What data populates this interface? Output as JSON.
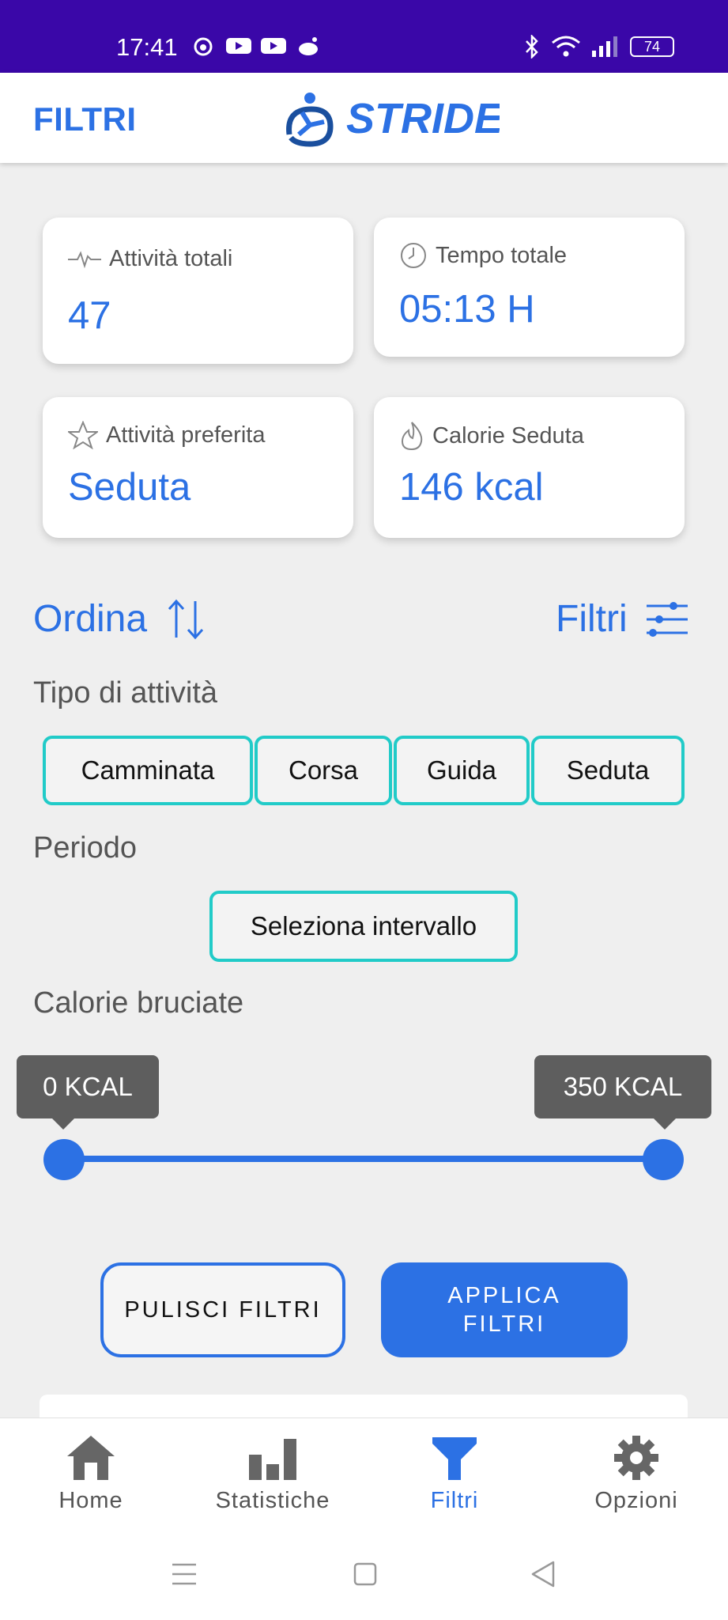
{
  "status_bar": {
    "time": "17:41",
    "battery": "74"
  },
  "app_bar": {
    "title": "FILTRI",
    "logo_text": "STRIDE"
  },
  "stats": {
    "total_activities": {
      "label": "Attività totali",
      "value": "47"
    },
    "total_time": {
      "label": "Tempo totale",
      "value": "05:13 H"
    },
    "favorite_activity": {
      "label": "Attività preferita",
      "value": "Seduta"
    },
    "calories": {
      "label": "Calorie Seduta",
      "value": "146 kcal"
    }
  },
  "sort": {
    "label": "Ordina"
  },
  "filters": {
    "label": "Filtri"
  },
  "activity_type": {
    "label": "Tipo di attività",
    "options": [
      "Camminata",
      "Corsa",
      "Guida",
      "Seduta"
    ]
  },
  "period": {
    "label": "Periodo",
    "button": "Seleziona intervallo"
  },
  "calories_range": {
    "label": "Calorie bruciate",
    "min_label": "0 KCAL",
    "max_label": "350 KCAL",
    "min": 0,
    "max": 350
  },
  "actions": {
    "clear": "PULISCI FILTRI",
    "apply": "APPLICA\nFILTRI"
  },
  "bottom_nav": [
    {
      "label": "Home",
      "icon": "home-icon"
    },
    {
      "label": "Statistiche",
      "icon": "bar-chart-icon"
    },
    {
      "label": "Filtri",
      "icon": "filter-icon",
      "active": true
    },
    {
      "label": "Opzioni",
      "icon": "gear-icon"
    }
  ],
  "colors": {
    "accent": "#2c71e4",
    "status_bar": "#3a07a8",
    "chip_border": "#21cbc8"
  }
}
